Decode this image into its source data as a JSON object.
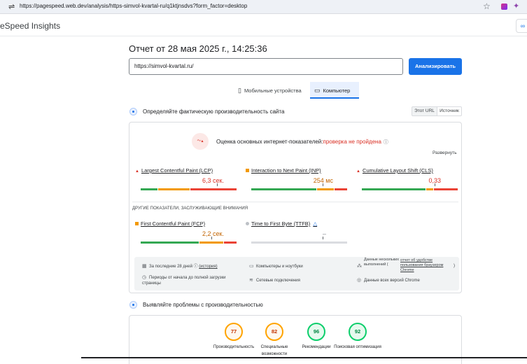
{
  "browser": {
    "url": "https://pagespeed.web.dev/analysis/https-simvol-kvartal-ru/q1ktjnsdvs?form_factor=desktop"
  },
  "app": {
    "brand": "eSpeed Insights"
  },
  "report": {
    "title": "Отчет от 28 мая 2025 г., 14:25:36"
  },
  "form": {
    "url_value": "https://simvol-kvartal.ru/",
    "analyze_label": "Анализировать"
  },
  "tabs": [
    {
      "label": "Мобильные устройства"
    },
    {
      "label": "Компьютер"
    }
  ],
  "field": {
    "title": "Определяйте фактическую производительность сайта",
    "toggle": [
      "Этот URL",
      "Источник"
    ],
    "assessment_label": "Оценка основных интернет-показателей:",
    "assessment_result": "проверка не пройдена",
    "expand_label": "Развернуть",
    "core_metrics": [
      {
        "name": "Largest Contentful Paint (LCP)",
        "value": "6,3 сек.",
        "status": "poor"
      },
      {
        "name": "Interaction to Next Paint (INP)",
        "value": "254 мс",
        "status": "needs-improvement"
      },
      {
        "name": "Cumulative Layout Shift (CLS)",
        "value": "0,33",
        "status": "poor"
      }
    ],
    "other_label": "ДРУГИЕ ПОКАЗАТЕЛИ, ЗАСЛУЖИВАЮЩИЕ ВНИМАНИЯ",
    "other_metrics": [
      {
        "name": "First Contentful Paint (FCP)",
        "value": "2,2 сек.",
        "status": "needs-improvement"
      },
      {
        "name": "Time to First Byte (TTFB)",
        "value": "–",
        "status": "none"
      }
    ],
    "info": {
      "period": "За последние 28 дней",
      "period_link": "(история)",
      "devices": "Компьютеры и ноутбуки",
      "crux_label": "Данные нескольких выполнений (",
      "crux_link": "отчет об удобстве пользования браузером Chrome",
      "crux_close": ")",
      "duration": "Периоды от начала до полной загрузки страницы",
      "network": "Сетевые подключения",
      "versions": "Данные всех версий Chrome"
    }
  },
  "diagnose": {
    "title": "Выявляйте проблемы с производительностью",
    "scores": [
      {
        "value": 77,
        "label": "Производительность",
        "level": "average"
      },
      {
        "value": 82,
        "label": "Специальные возможности",
        "level": "average"
      },
      {
        "value": 96,
        "label": "Рекомендации",
        "level": "good"
      },
      {
        "value": 92,
        "label": "Поисковая оптимизация",
        "level": "good"
      }
    ]
  },
  "colors": {
    "accent": "#1a73e8",
    "fail": "#d93025",
    "average": "#ffa400",
    "good": "#0cce6b"
  }
}
